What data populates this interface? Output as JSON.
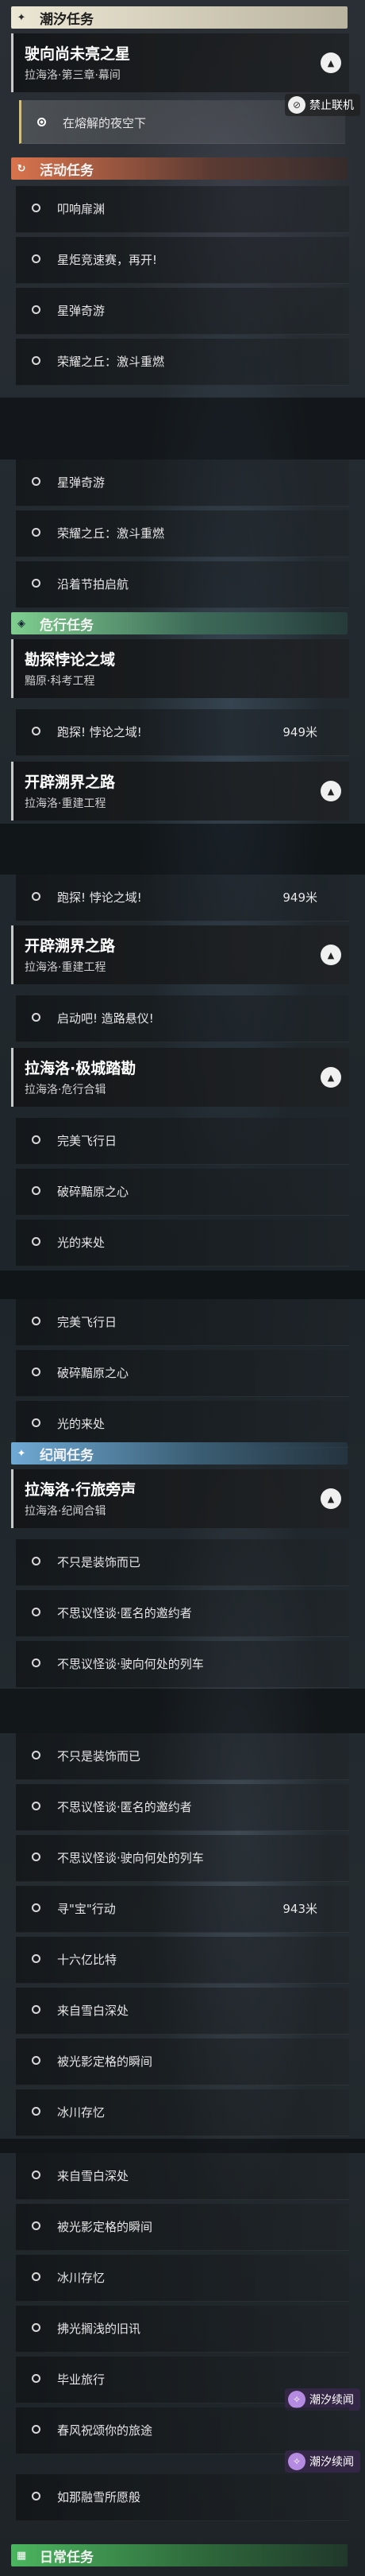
{
  "categories": {
    "tidal": {
      "label": "潮汐任务",
      "icon": "✦",
      "color": "#ece7d4",
      "iconColor": "#2a2a2a"
    },
    "event": {
      "label": "活动任务",
      "icon": "↻",
      "color": "#d9734c",
      "iconColor": "#fff"
    },
    "danger": {
      "label": "危行任务",
      "icon": "◈",
      "color": "#7fcf8f",
      "iconColor": "#123"
    },
    "chronicle": {
      "label": "纪闻任务",
      "icon": "✦",
      "color": "#6ea9d4",
      "iconColor": "#fff"
    },
    "daily": {
      "label": "日常任务",
      "icon": "▦",
      "color": "#4bb55f",
      "iconColor": "#fff"
    }
  },
  "quests": {
    "q1": {
      "title": "驶向尚未亮之星",
      "subtitle": "拉海洛·第三章·幕间"
    },
    "q1_item": "在熔解的夜空下",
    "coop_badge": "禁止联机",
    "event_items": [
      "叩响扉渊",
      "星炬竞速赛，再开!",
      "星弹奇游",
      "荣耀之丘：激斗重燃"
    ],
    "event_items_b": [
      "星弹奇游",
      "荣耀之丘：激斗重燃",
      "沿着节拍启航"
    ],
    "q2": {
      "title": "勘探悖论之域",
      "subtitle": "黯原·科考工程"
    },
    "q2_item": "跑探! 悖论之域!",
    "q2_dist": "949米",
    "q3": {
      "title": "开辟溯界之路",
      "subtitle": "拉海洛·重建工程"
    },
    "q3_item": "跑探! 悖论之域!",
    "q3_dist": "949米",
    "q3b": {
      "title": "开辟溯界之路",
      "subtitle": "拉海洛·重建工程"
    },
    "q3b_item": "启动吧! 造路悬仪!",
    "q4": {
      "title": "拉海洛·极城踏勘",
      "subtitle": "拉海洛·危行合辑"
    },
    "q4_items": [
      "完美飞行日",
      "破碎黯原之心",
      "光的来处"
    ],
    "q4_items_b": [
      "完美飞行日",
      "破碎黯原之心",
      "光的来处"
    ],
    "q5": {
      "title": "拉海洛·行旅旁声",
      "subtitle": "拉海洛·纪闻合辑"
    },
    "q5_items": [
      "不只是装饰而已",
      "不思议怪谈·匿名的邀约者",
      "不思议怪谈·驶向何处的列车"
    ],
    "q5_items_b": [
      "不只是装饰而已",
      "不思议怪谈·匿名的邀约者",
      "不思议怪谈·驶向何处的列车",
      "寻\"宝\"行动",
      "十六亿比特",
      "来自雪白深处",
      "被光影定格的瞬间",
      "冰川存忆"
    ],
    "q5_dist": "943米",
    "q5_items_c": [
      "来自雪白深处",
      "被光影定格的瞬间",
      "冰川存忆",
      "拂光搁浅的旧讯",
      "毕业旅行",
      "春风祝颂你的旅途",
      "如那融雪所愿般"
    ],
    "tide_badge": "潮汐续闻"
  }
}
